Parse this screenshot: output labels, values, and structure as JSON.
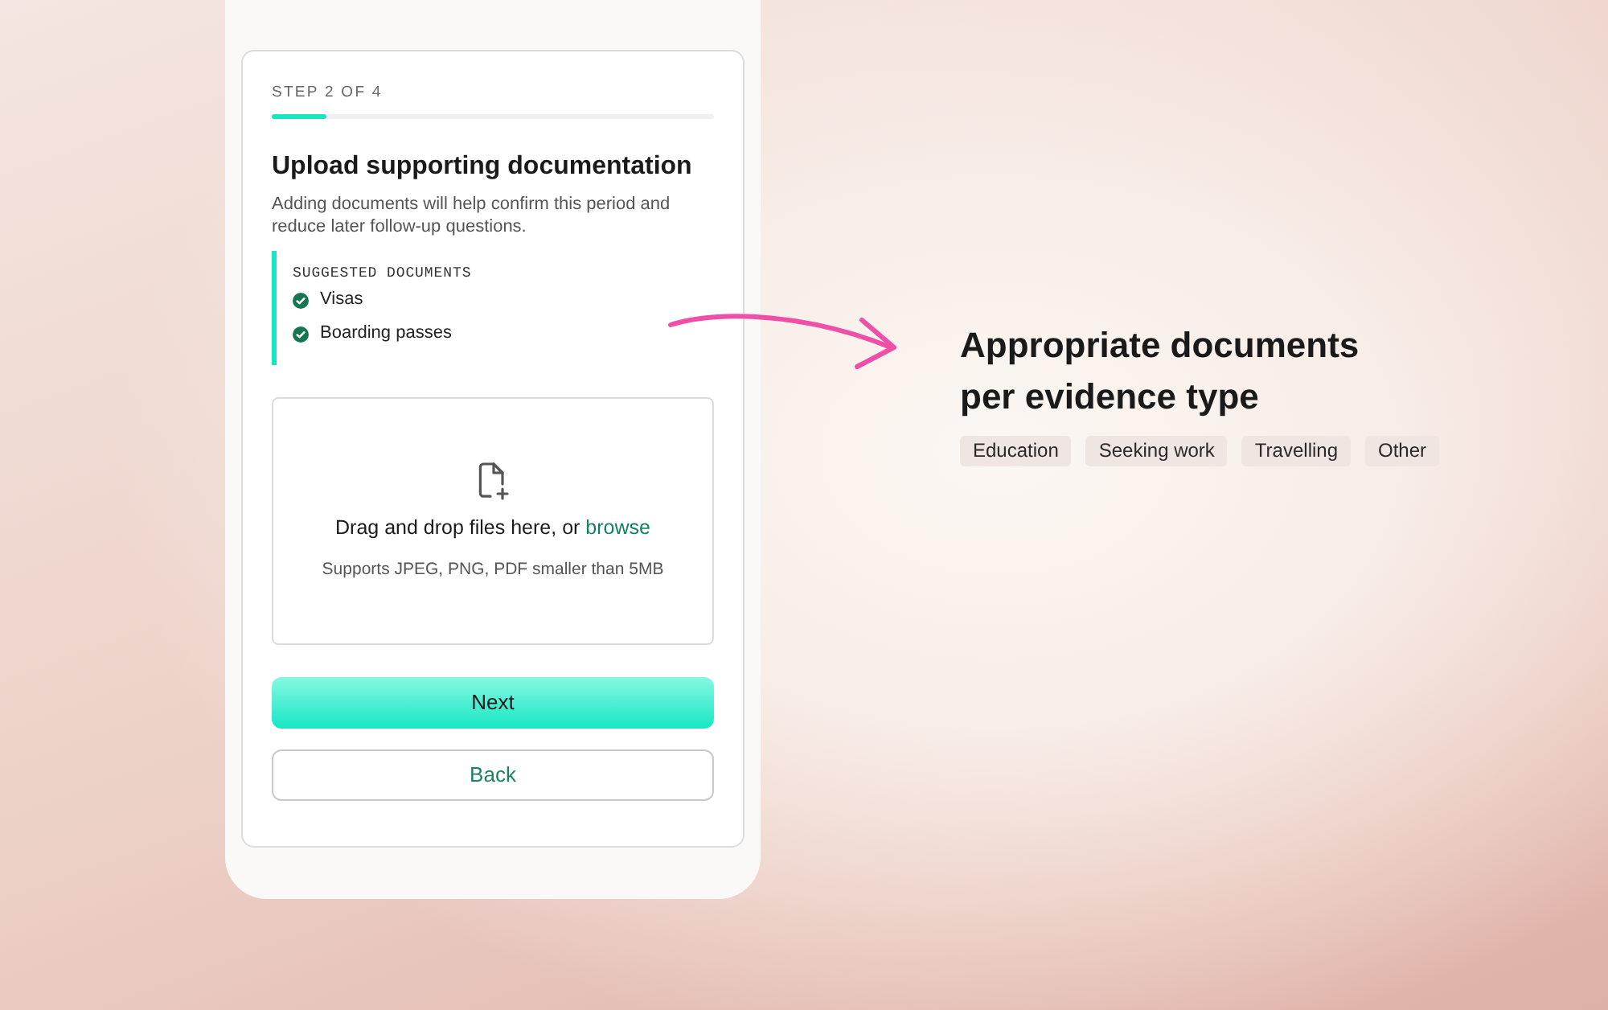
{
  "step": {
    "label": "STEP 2 OF 4",
    "level": 0.125
  },
  "heading": "Upload supporting documentation",
  "description": "Adding documents will help confirm this period and reduce later follow-up questions.",
  "suggested": {
    "title": "SUGGESTED DOCUMENTS",
    "items": [
      "Visas",
      "Boarding passes"
    ]
  },
  "dropzone": {
    "text": "Drag and drop files here, or",
    "link": "browse",
    "hint": "Supports JPEG, PNG, PDF smaller than 5MB"
  },
  "buttons": [
    {
      "label": "Next",
      "kind": "primary"
    },
    {
      "label": "Back",
      "kind": "secondary"
    }
  ],
  "callout": {
    "title": "Appropriate documents per evidence type",
    "tags": [
      "Education",
      "Seeking work",
      "Travelling",
      "Other"
    ]
  }
}
